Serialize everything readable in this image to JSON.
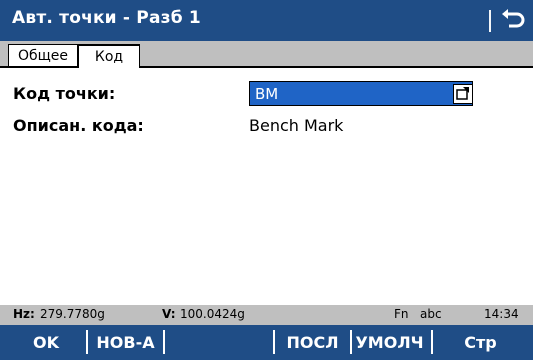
{
  "titlebar": {
    "title": "Авт. точки - Разб 1",
    "back_icon": "back-arrow-icon"
  },
  "tabs": {
    "general": "Общее",
    "code": "Код"
  },
  "form": {
    "point_code_label": "Код точки:",
    "point_code_value": "BM",
    "code_desc_label": "Описан. кода:",
    "code_desc_value": "Bench Mark"
  },
  "status": {
    "hz_label": "Hz:",
    "hz_value": "279.7780g",
    "v_label": "V:",
    "v_value": "100.0424g",
    "fn": "Fn",
    "input_mode": "abc",
    "time": "14:34"
  },
  "softkeys": {
    "ok": "OK",
    "new": "НОВ-А",
    "last": "ПОСЛ",
    "default": "УМОЛЧ",
    "page": "Стр"
  },
  "colors": {
    "title_blue": "#1f4d86",
    "field_blue": "#1f64c6",
    "tab_gray": "#bfbfbf"
  }
}
